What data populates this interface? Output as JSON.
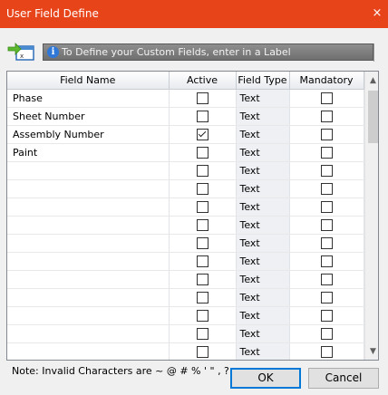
{
  "window": {
    "title": "User Field Define",
    "close_glyph": "×"
  },
  "info": {
    "icon": "info-icon",
    "message": "To Define your Custom Fields, enter in a  Label"
  },
  "grid": {
    "headers": [
      "Field Name",
      "Active",
      "Field Type",
      "Mandatory"
    ],
    "rows": [
      {
        "name": "Phase",
        "active": false,
        "type": "Text",
        "mandatory": false
      },
      {
        "name": "Sheet Number",
        "active": false,
        "type": "Text",
        "mandatory": false
      },
      {
        "name": "Assembly Number",
        "active": true,
        "type": "Text",
        "mandatory": false
      },
      {
        "name": "Paint",
        "active": false,
        "type": "Text",
        "mandatory": false
      },
      {
        "name": "",
        "active": false,
        "type": "Text",
        "mandatory": false
      },
      {
        "name": "",
        "active": false,
        "type": "Text",
        "mandatory": false
      },
      {
        "name": "",
        "active": false,
        "type": "Text",
        "mandatory": false
      },
      {
        "name": "",
        "active": false,
        "type": "Text",
        "mandatory": false
      },
      {
        "name": "",
        "active": false,
        "type": "Text",
        "mandatory": false
      },
      {
        "name": "",
        "active": false,
        "type": "Text",
        "mandatory": false
      },
      {
        "name": "",
        "active": false,
        "type": "Text",
        "mandatory": false
      },
      {
        "name": "",
        "active": false,
        "type": "Text",
        "mandatory": false
      },
      {
        "name": "",
        "active": false,
        "type": "Text",
        "mandatory": false
      },
      {
        "name": "",
        "active": false,
        "type": "Text",
        "mandatory": false
      },
      {
        "name": "",
        "active": false,
        "type": "Text",
        "mandatory": false
      }
    ]
  },
  "note": "Note: Invalid Characters are ~ @ # %  ' \" , ?",
  "buttons": {
    "ok": "OK",
    "cancel": "Cancel"
  },
  "colors": {
    "titlebar": "#e8441a",
    "info_bar": "#7d7d7d",
    "ok_border": "#0078d7"
  }
}
